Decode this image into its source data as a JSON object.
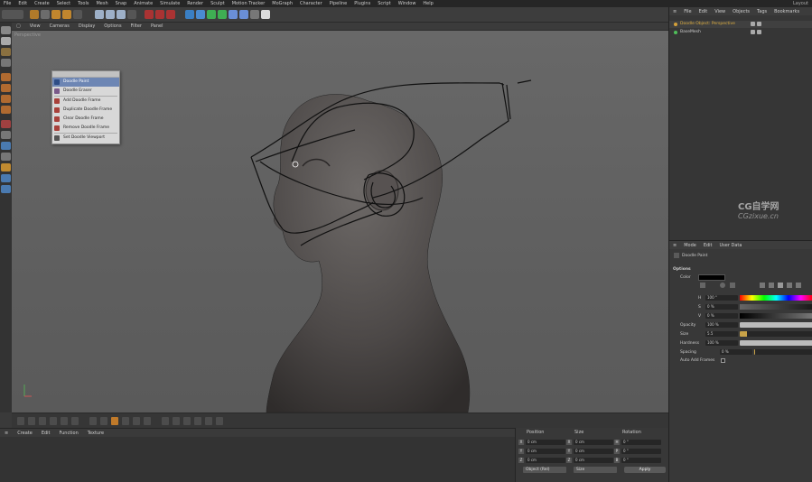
{
  "menubar": {
    "items": [
      "File",
      "Edit",
      "Create",
      "Select",
      "Tools",
      "Mesh",
      "Snap",
      "Animate",
      "Simulate",
      "Render",
      "Sculpt",
      "Motion Tracker",
      "MoGraph",
      "Character",
      "Pipeline",
      "Plugins",
      "Script",
      "Window",
      "Help"
    ],
    "layout_label": "Layout"
  },
  "viewport": {
    "menu": [
      "View",
      "Cameras",
      "Display",
      "Options",
      "Filter",
      "Panel"
    ],
    "label": "Perspective"
  },
  "doodle_menu": {
    "items": [
      "Doodle Paint",
      "Doodle Eraser",
      "Add Doodle Frame",
      "Duplicate Doodle Frame",
      "Clear Doodle Frame",
      "Remove Doodle Frame",
      "Set Doodle Viewport"
    ],
    "selected": 0
  },
  "material": {
    "menu": [
      "Create",
      "Edit",
      "Function",
      "Texture"
    ]
  },
  "coordinates": {
    "headers": [
      "Position",
      "Size",
      "Rotation"
    ],
    "rows": [
      {
        "axis": [
          "X",
          "X",
          "H"
        ],
        "values": [
          "0 cm",
          "0 cm",
          "0 °"
        ]
      },
      {
        "axis": [
          "Y",
          "Y",
          "P"
        ],
        "values": [
          "0 cm",
          "0 cm",
          "0 °"
        ]
      },
      {
        "axis": [
          "Z",
          "Z",
          "B"
        ],
        "values": [
          "0 cm",
          "0 cm",
          "0 °"
        ]
      }
    ],
    "mode": "Object (Rel)",
    "size_mode": "Size",
    "apply": "Apply"
  },
  "objects": {
    "menu": [
      "File",
      "Edit",
      "View",
      "Objects",
      "Tags",
      "Bookmarks"
    ],
    "items": [
      {
        "name": "Doodle Object: Perspective",
        "color": "#e0b040",
        "dot": "#d4a03a"
      },
      {
        "name": "BaseMesh",
        "color": "#cccccc",
        "dot": "#4fbf5a"
      }
    ]
  },
  "watermark": {
    "line1": "CG自学网",
    "line2": "CGzixue.cn"
  },
  "attributes": {
    "menu": [
      "Mode",
      "Edit",
      "User Data"
    ],
    "title": "Doodle Paint",
    "section": "Options",
    "color_label": "Color",
    "h_label": "H",
    "h_value": "100 °",
    "s_label": "S",
    "s_value": "0 %",
    "v_label": "V",
    "v_value": "0 %",
    "opacity_label": "Opacity",
    "opacity_value": "100 %",
    "size_label": "Size",
    "size_value": "5.5",
    "hardness_label": "Hardness",
    "hardness_value": "100 %",
    "spacing_label": "Spacing",
    "spacing_value": "0 %",
    "auto_add_label": "Auto Add Frames",
    "size_fill": 0.1,
    "spacing_fill": 0.0
  },
  "colors": {
    "accent": "#c9a348",
    "selected": "#6d86b4"
  }
}
